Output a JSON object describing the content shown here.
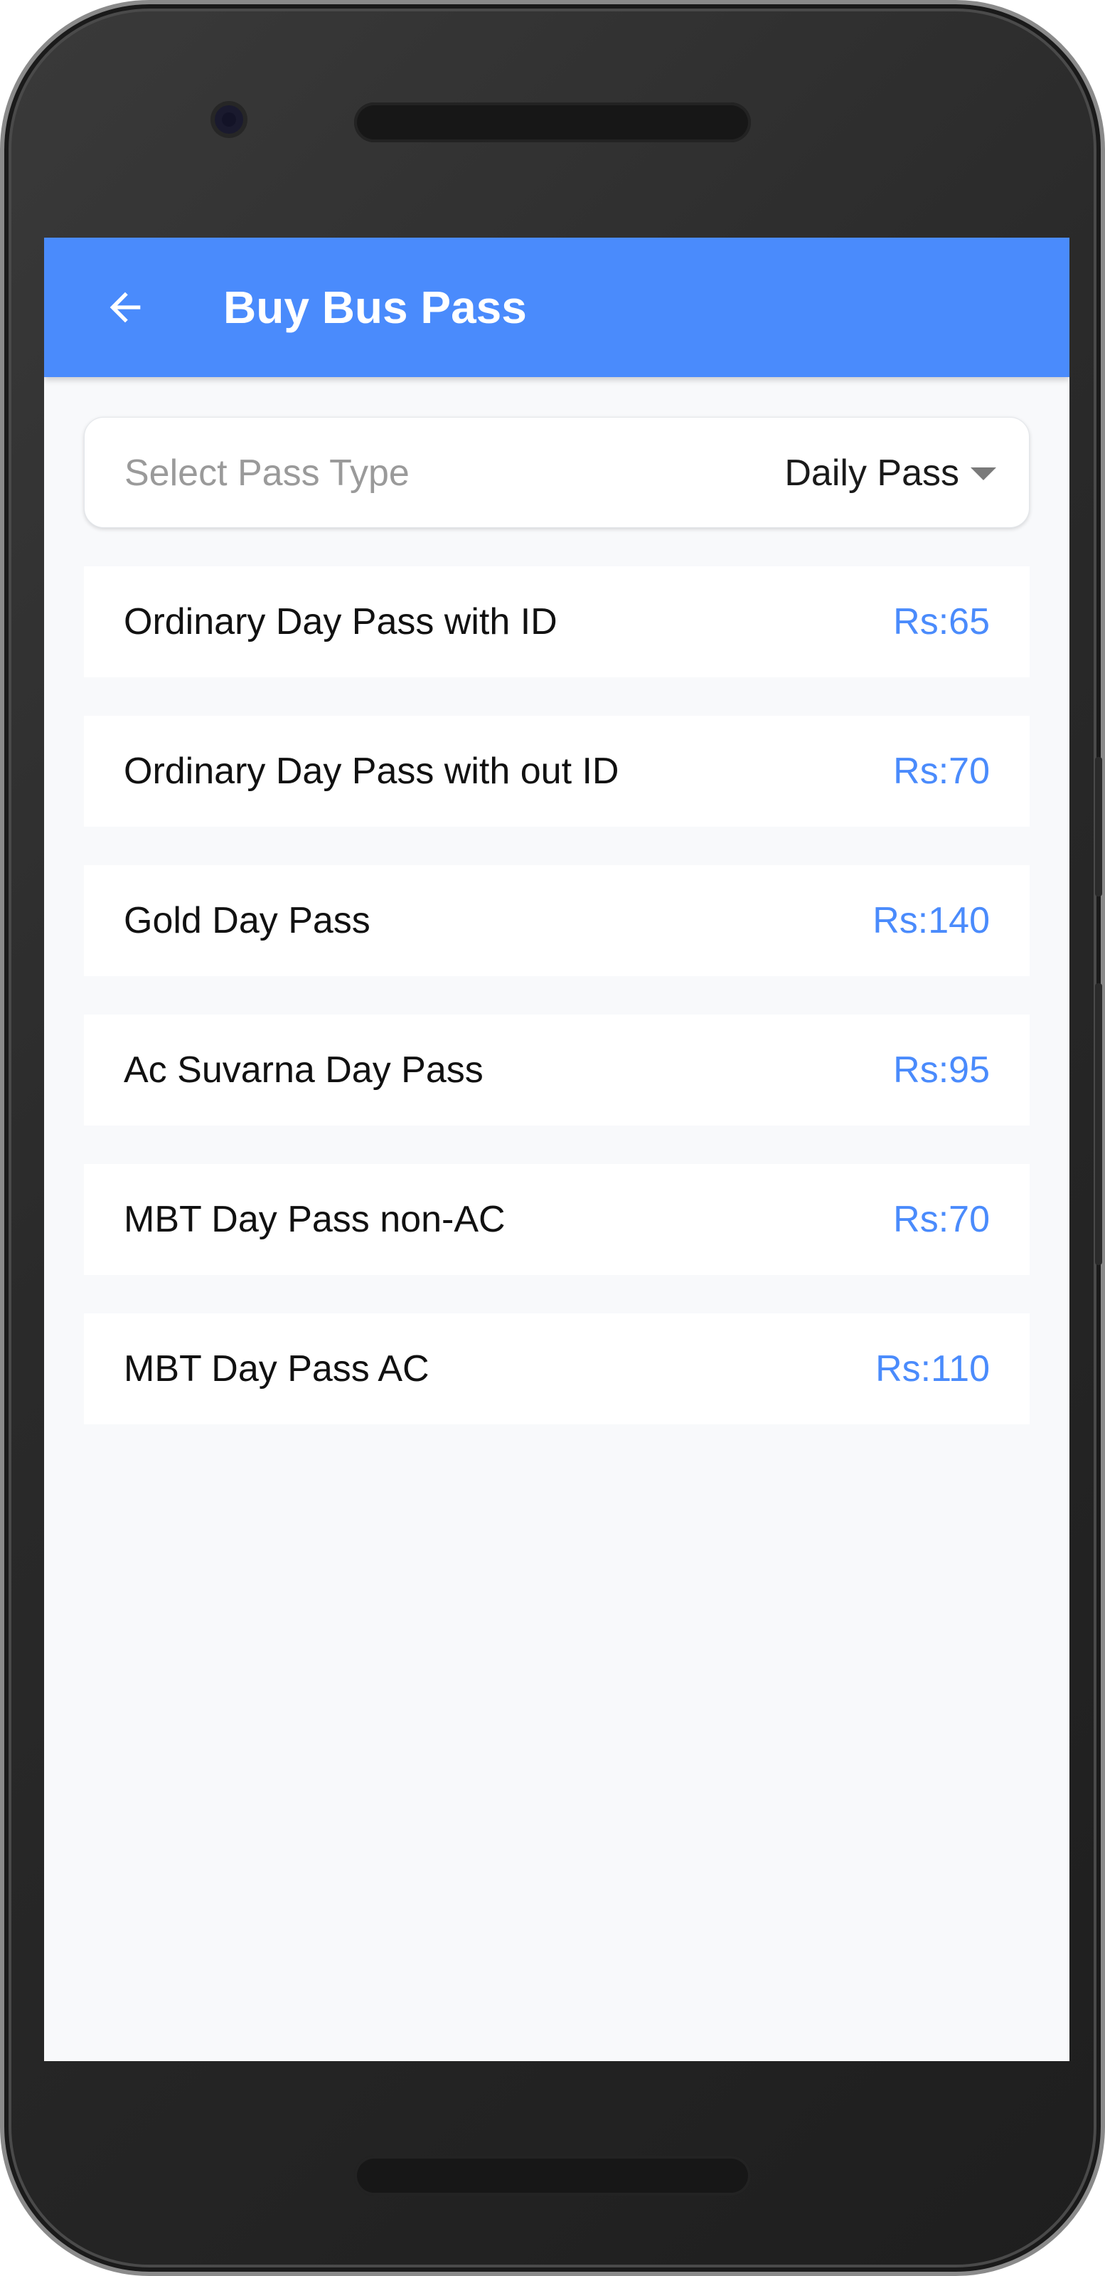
{
  "app_bar": {
    "title": "Buy Bus Pass",
    "back_icon": "arrow-left-icon",
    "color": "#4a8bfc"
  },
  "pass_type_select": {
    "label": "Select Pass Type",
    "selected_value": "Daily Pass",
    "caret_icon": "caret-down-icon"
  },
  "passes": [
    {
      "name": "Ordinary Day Pass with ID",
      "price": "Rs:65"
    },
    {
      "name": "Ordinary Day Pass with out ID",
      "price": "Rs:70"
    },
    {
      "name": "Gold Day Pass",
      "price": "Rs:140"
    },
    {
      "name": "Ac Suvarna Day Pass",
      "price": "Rs:95"
    },
    {
      "name": "MBT Day Pass non-AC",
      "price": "Rs:70"
    },
    {
      "name": "MBT Day Pass AC",
      "price": "Rs:110"
    }
  ],
  "colors": {
    "accent": "#4a8bfc",
    "screen_background": "#f8f9fb",
    "text_primary": "#111111",
    "text_secondary": "#9a9a9a"
  }
}
